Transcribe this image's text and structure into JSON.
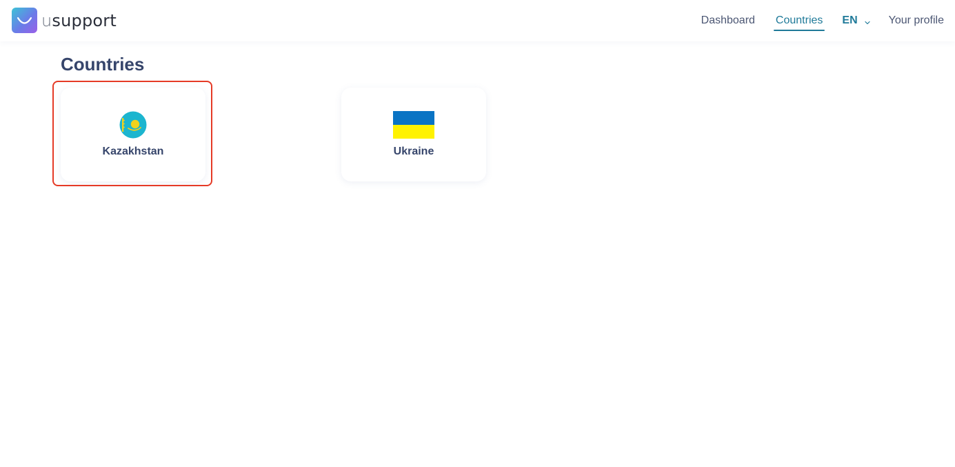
{
  "header": {
    "logo_prefix": "u",
    "logo_rest": "support",
    "nav": {
      "dashboard": "Dashboard",
      "countries": "Countries",
      "language": "EN",
      "profile": "Your profile"
    }
  },
  "main": {
    "title": "Countries",
    "countries": [
      {
        "name": "Kazakhstan",
        "flag_icon": "kazakhstan-flag-icon",
        "selected": true
      },
      {
        "name": "Ukraine",
        "flag_icon": "ukraine-flag-icon",
        "selected": false
      }
    ]
  },
  "colors": {
    "accent": "#1f7a99",
    "heading": "#36456b",
    "highlight": "#e53a26",
    "ukraine_blue": "#0a74c4",
    "ukraine_yellow": "#fff200",
    "kazakhstan_blue": "#1cb5cf",
    "kazakhstan_gold": "#f2d21b"
  }
}
